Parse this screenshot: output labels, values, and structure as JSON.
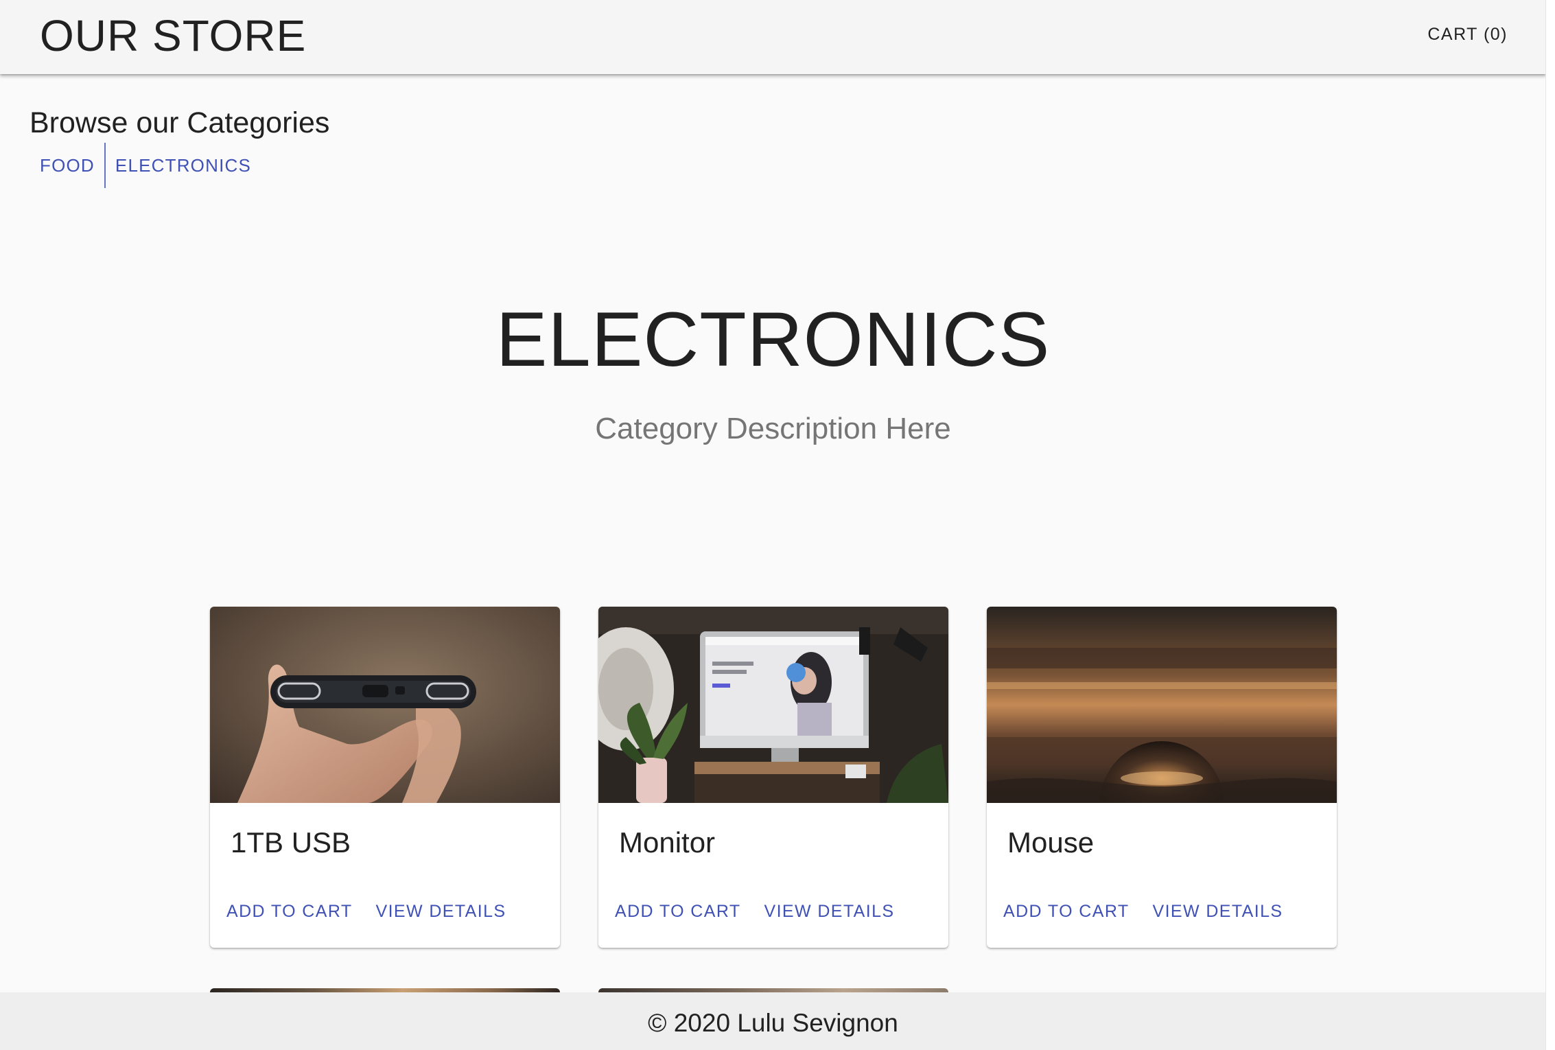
{
  "header": {
    "brand": "OUR STORE",
    "cart_label": "CART (0)"
  },
  "categories": {
    "title": "Browse our Categories",
    "links": [
      "FOOD",
      "ELECTRONICS"
    ]
  },
  "hero": {
    "title": "ELECTRONICS",
    "subtitle": "Category Description Here"
  },
  "products": [
    {
      "name": "1TB USB",
      "image": "usb-drive-photo",
      "add_label": "ADD TO CART",
      "details_label": "VIEW DETAILS"
    },
    {
      "name": "Monitor",
      "image": "desk-monitor-photo",
      "add_label": "ADD TO CART",
      "details_label": "VIEW DETAILS"
    },
    {
      "name": "Mouse",
      "image": "glass-sphere-sunset-photo",
      "add_label": "ADD TO CART",
      "details_label": "VIEW DETAILS"
    }
  ],
  "footer": {
    "copyright": "© 2020 Lulu Sevignon"
  },
  "colors": {
    "accent": "#3f51b5",
    "appbar": "#f5f5f5",
    "background": "#fafafa",
    "footer": "#eeeeee"
  }
}
